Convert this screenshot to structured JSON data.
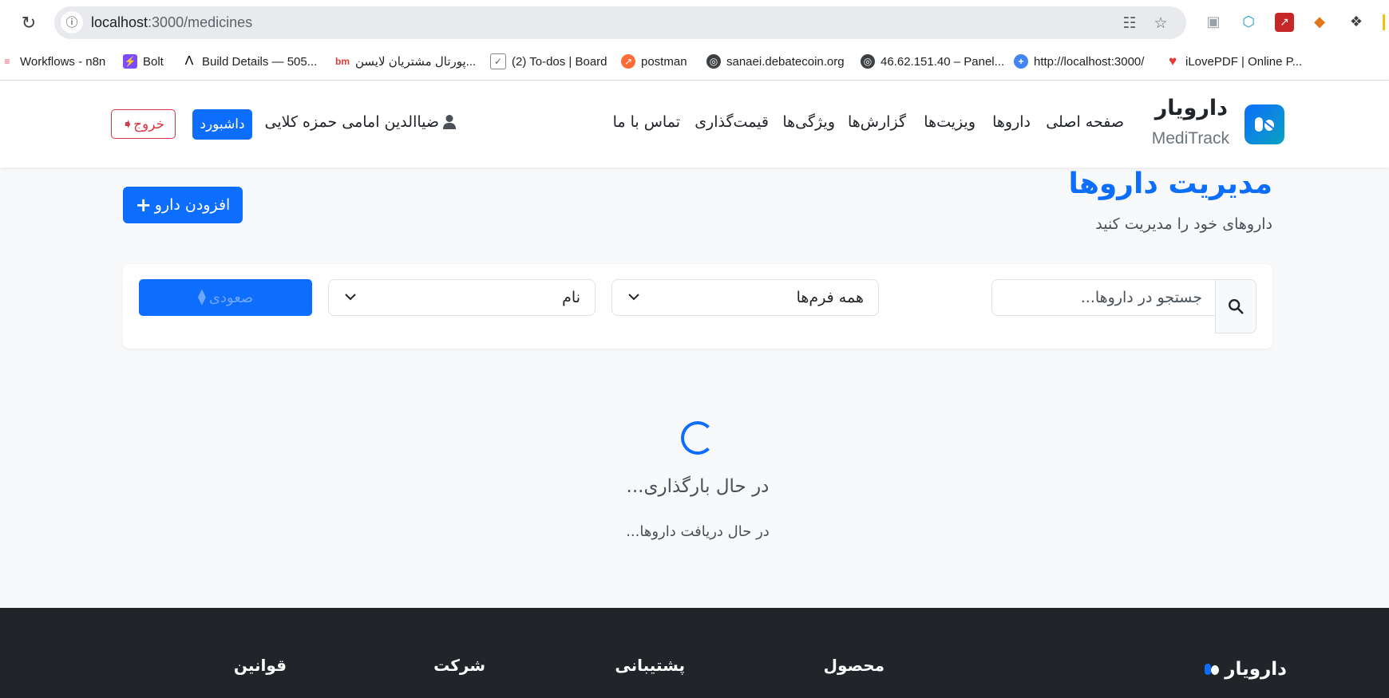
{
  "browser": {
    "url_host": "localhost",
    "url_path": ":3000/medicines",
    "bookmarks": [
      {
        "label": "Workflows - n8n",
        "icon": "n8n-icon"
      },
      {
        "label": "Bolt",
        "icon": "bolt-icon"
      },
      {
        "label": "Build Details — 505...",
        "icon": "vercel-icon"
      },
      {
        "label": "پورتال مشتریان لایسن...",
        "icon": "bm-icon"
      },
      {
        "label": "(2) To-dos | Board",
        "icon": "checkbox-icon"
      },
      {
        "label": "postman",
        "icon": "postman-icon"
      },
      {
        "label": "sanaei.debatecoin.org",
        "icon": "globe-icon"
      },
      {
        "label": "46.62.151.40 – Panel...",
        "icon": "globe-icon"
      },
      {
        "label": "http://localhost:3000/",
        "icon": "plus-circle-icon"
      },
      {
        "label": "iLovePDF | Online P...",
        "icon": "heart-icon"
      }
    ]
  },
  "navbar": {
    "brand_title": "دارویار",
    "brand_subtitle": "MediTrack",
    "links": [
      "صفحه اصلی",
      "داروها",
      "ویزیت‌ها",
      "گزارش‌ها",
      "ویژگی‌ها",
      "قیمت‌گذاری",
      "تماس با ما"
    ],
    "user_name": "ضیاالدین امامی حمزه کلایی",
    "dashboard_label": "داشبورد",
    "logout_label": "خروج"
  },
  "page": {
    "title": "مدیریت داروها",
    "subtitle": "داروهای خود را مدیریت کنید",
    "add_label": "افزودن دارو"
  },
  "filters": {
    "search_placeholder": "جستجو در داروها...",
    "form_selected": "همه فرم‌ها",
    "sort_selected": "نام",
    "order_label": "صعودی"
  },
  "loading": {
    "title": "در حال بارگذاری...",
    "subtitle": "در حال دریافت داروها..."
  },
  "footer": {
    "brand": "دارویار",
    "headings": [
      "محصول",
      "پشتیبانی",
      "شرکت",
      "قوانین"
    ]
  },
  "colors": {
    "primary": "#0d6efd",
    "danger": "#dc3545",
    "footer_bg": "#212529"
  }
}
